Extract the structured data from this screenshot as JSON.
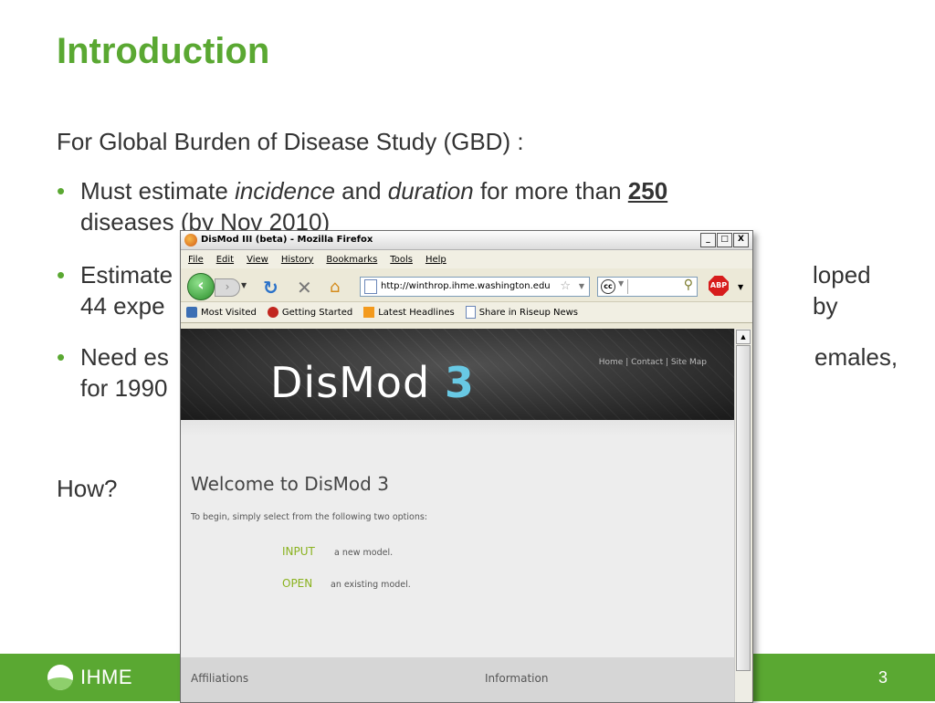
{
  "slide": {
    "title": "Introduction",
    "intro": "For Global Burden of Disease Study (GBD) :",
    "bullets": {
      "b1_pre": "Must estimate ",
      "b1_em1": "incidence",
      "b1_mid": " and ",
      "b1_em2": "duration",
      "b1_post": " for more than ",
      "b1_num": "250",
      "b1_line2": "diseases (by Nov 2010)",
      "b2_a": "Estimate",
      "b2_b": "loped by",
      "b2_c": "44 expe",
      "b3_a": "Need es",
      "b3_b": "emales,",
      "b3_c": "for 1990"
    },
    "how": "How?",
    "logo_text": "IHME",
    "page_number": "3"
  },
  "browser": {
    "window_title": "DisMod III (beta) - Mozilla Firefox",
    "win_min": "_",
    "win_max": "□",
    "win_close": "X",
    "menu": [
      "File",
      "Edit",
      "View",
      "History",
      "Bookmarks",
      "Tools",
      "Help"
    ],
    "url": "http://winthrop.ihme.washington.edu",
    "search_cc": "cc",
    "abp_label": "ABP",
    "bookmarks": [
      "Most Visited",
      "Getting Started",
      "Latest Headlines",
      "Share in Riseup News"
    ]
  },
  "page": {
    "logo_main": "DisMod",
    "logo_num": "3",
    "sitenav": "Home | Contact | Site Map",
    "welcome": "Welcome to DisMod 3",
    "intro": "To begin, simply select from the following two options:",
    "opt1_label": "INPUT",
    "opt1_desc": "a new model.",
    "opt2_label": "OPEN",
    "opt2_desc": "an existing model.",
    "footer_left": "Affiliations",
    "footer_right": "Information"
  },
  "colors": {
    "accent": "#5aa832",
    "link_green": "#8ab21f",
    "logo_blue": "#68c9e4"
  }
}
